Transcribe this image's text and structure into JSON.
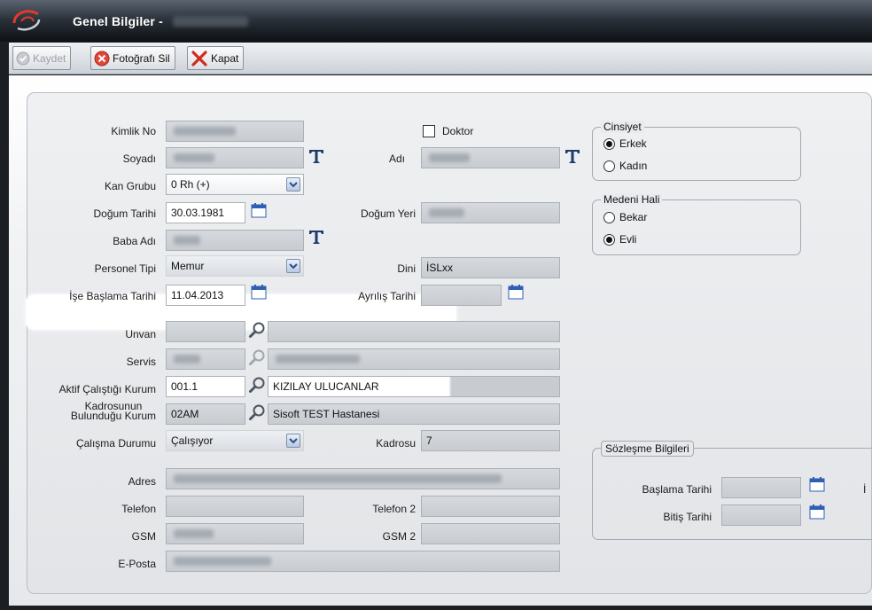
{
  "window": {
    "title": "Genel Bilgiler -"
  },
  "toolbar": {
    "save_label": "Kaydet",
    "delete_photo_label": "Fotoğrafı Sil",
    "close_label": "Kapat"
  },
  "form": {
    "kimlik_no": {
      "label": "Kimlik No"
    },
    "doktor": {
      "label": "Doktor",
      "checked": false
    },
    "soyadi": {
      "label": "Soyadı"
    },
    "adi": {
      "label": "Adı"
    },
    "kan_grubu": {
      "label": "Kan Grubu",
      "value": "0 Rh (+)"
    },
    "dogum_tarihi": {
      "label": "Doğum Tarihi",
      "value": "30.03.1981"
    },
    "dogum_yeri": {
      "label": "Doğum Yeri"
    },
    "baba_adi": {
      "label": "Baba Adı"
    },
    "personel_tipi": {
      "label": "Personel Tipi",
      "value": "Memur"
    },
    "dini": {
      "label": "Dini",
      "value": "İSLxx"
    },
    "ise_baslama": {
      "label": "İşe Başlama Tarihi",
      "value": "11.04.2013"
    },
    "ayrilis": {
      "label": "Ayrılış Tarihi",
      "value": ""
    },
    "unvan": {
      "label": "Unvan",
      "code": "",
      "name": ""
    },
    "servis": {
      "label": "Servis"
    },
    "aktif_kurum": {
      "label": "Aktif Çalıştığı Kurum",
      "code": "001.1",
      "name": "KIZILAY ULUCANLAR"
    },
    "kadro_kurum": {
      "label_line1": "Kadrosunun",
      "label_line2": "Bulunduğu Kurum",
      "code": "02AM",
      "name": "Sisoft TEST Hastanesi"
    },
    "calisma_durumu": {
      "label": "Çalışma Durumu",
      "value": "Çalışıyor"
    },
    "kadrosu": {
      "label": "Kadrosu",
      "value": "7"
    },
    "adres": {
      "label": "Adres"
    },
    "telefon": {
      "label": "Telefon",
      "value": ""
    },
    "telefon2": {
      "label": "Telefon 2",
      "value": ""
    },
    "gsm": {
      "label": "GSM"
    },
    "gsm2": {
      "label": "GSM 2",
      "value": ""
    },
    "eposta": {
      "label": "E-Posta"
    }
  },
  "cinsiyet": {
    "title": "Cinsiyet",
    "options": [
      "Erkek",
      "Kadın"
    ],
    "selected": "Erkek"
  },
  "medeni_hali": {
    "title": "Medeni Hali",
    "options": [
      "Bekar",
      "Evli"
    ],
    "selected": "Evli"
  },
  "sozlesme": {
    "title": "Sözleşme Bilgileri",
    "baslama_label": "Başlama Tarihi",
    "bitis_label": "Bitiş Tarihi",
    "cut_label": "İ"
  },
  "colors": {
    "titlebar": "#0e1115",
    "panel": "#e2e4e7",
    "calendar_blue": "#2f5fb3",
    "typo_icon_navy": "#1f3a6e"
  },
  "icons": [
    "app-logo-icon",
    "disabled-save-icon",
    "delete-photo-icon",
    "close-x-icon",
    "calendar-icon",
    "search-magnifier-icon",
    "text-typo-icon",
    "chevron-down-icon"
  ]
}
